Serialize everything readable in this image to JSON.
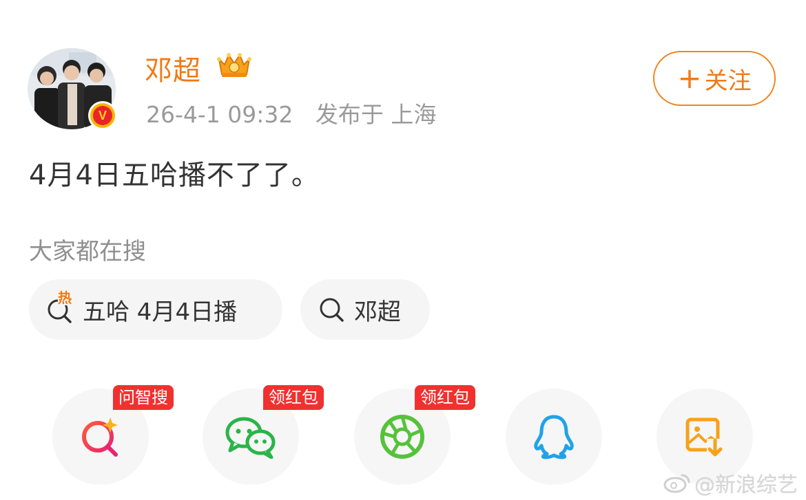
{
  "author": {
    "name": "邓超",
    "time": "26-4-1 09:32",
    "location": "发布于 上海",
    "verified_glyph": "V",
    "badge_icon": "crown-icon",
    "colors": {
      "name": "#f07a16",
      "badge": "#f7b500"
    }
  },
  "follow_button": {
    "plus": "+",
    "label": "关注"
  },
  "post": {
    "text": "4月4日五哈播不了了。"
  },
  "search": {
    "heading": "大家都在搜",
    "chips": [
      {
        "label": "五哈 4月4日播",
        "icon": "hot-search-icon",
        "hot_glyph": "热"
      },
      {
        "label": "邓超",
        "icon": "search-icon"
      }
    ]
  },
  "share": {
    "items": [
      {
        "icon": "ai-search-icon",
        "tag": "问智搜"
      },
      {
        "icon": "wechat-icon",
        "tag": "领红包"
      },
      {
        "icon": "moments-icon",
        "tag": "领红包"
      },
      {
        "icon": "qq-icon"
      },
      {
        "icon": "save-image-icon"
      }
    ],
    "tag_color": "#f0312f"
  },
  "watermark": {
    "text": "@新浪综艺"
  }
}
